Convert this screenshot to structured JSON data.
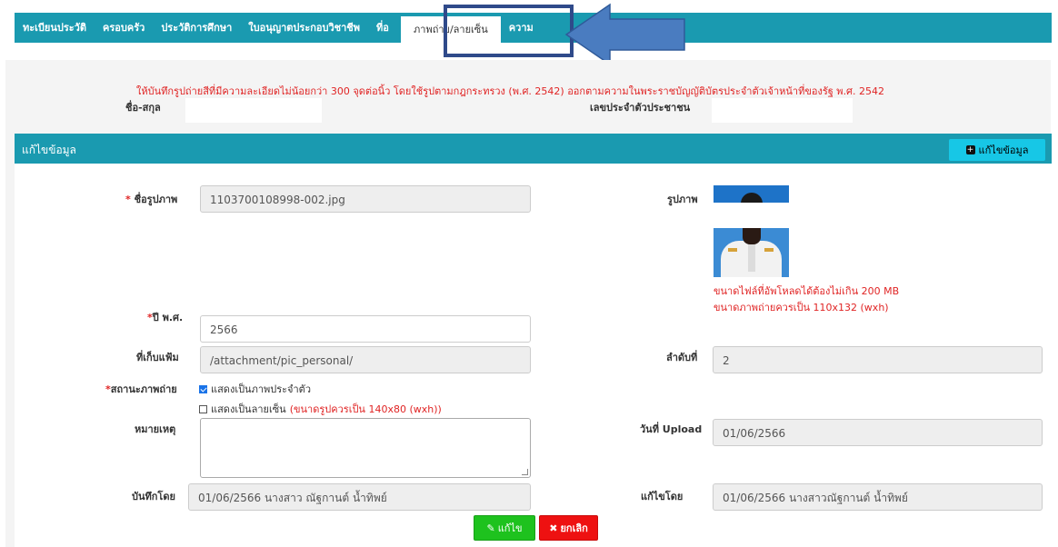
{
  "tabs": [
    {
      "label": "ทะเบียนประวัติ"
    },
    {
      "label": "ครอบครัว"
    },
    {
      "label": "ประวัติการศึกษา"
    },
    {
      "label": "ใบอนุญาตประกอบวิชาชีพ"
    },
    {
      "label": "ที่อ"
    },
    {
      "label": "ภาพถ่าย/ลายเซ็น",
      "active": true
    },
    {
      "label": "ความ"
    }
  ],
  "notice": "ให้บันทึกรูปถ่ายสีที่มีความละเอียดไม่น้อยกว่า 300 จุดต่อนิ้ว โดยใช้รูปตามกฎกระทรวง (พ.ศ. 2542) ออกตามความในพระราชบัญญัติบัตรประจำตัวเจ้าหน้าที่ของรัฐ พ.ศ. 2542",
  "header_fields": {
    "name_label": "ชื่อ-สกุล",
    "id_label": "เลขประจำตัวประชาชน"
  },
  "section": {
    "title": "แก้ไขข้อมูล",
    "edit_button": "แก้ไขข้อมูล",
    "collapse": "−"
  },
  "form": {
    "required_mark": "*",
    "image_name_label": "ชื่อรูปภาพ",
    "image_name_value": "1103700108998-002.jpg",
    "image_label": "รูปภาพ",
    "upload_size_note": "ขนาดไฟล์ที่อัพโหลดได้ต้องไม่เกิน 200 MB",
    "photo_size_note": "ขนาดภาพถ่ายควรเป็น 110x132 (wxh)",
    "year_label": "ปี พ.ศ.",
    "year_value": "2566",
    "folder_label": "ที่เก็บแฟ้ม",
    "folder_value": "/attachment/pic_personal/",
    "order_label": "ลำดับที่",
    "order_value": "2",
    "status_label": "สถานะภาพถ่าย",
    "option_profile": "แสดงเป็นภาพประจำตัว",
    "option_profile_checked": true,
    "option_signature": "แสดงเป็นลายเซ็น",
    "option_signature_checked": false,
    "signature_size_note": "(ขนาดรูปควรเป็น 140x80 (wxh))",
    "remark_label": "หมายเหตุ",
    "remark_value": "",
    "upload_date_label": "วันที่ Upload",
    "upload_date_value": "01/06/2566",
    "recorded_by_label": "บันทึกโดย",
    "recorded_by_value": "01/06/2566 นางสาว ณัฐกานต์  น้ำทิพย์",
    "edited_by_label": "แก้ไขโดย",
    "edited_by_value": "01/06/2566 นางสาวณัฐกานต์  น้ำทิพย์"
  },
  "buttons": {
    "save": "แก้ไข",
    "cancel": "ยกเลิก"
  },
  "colors": {
    "teal": "#1a9ab0",
    "red": "#e02424",
    "highlight_border": "#2f4a8a",
    "arrow": "#4a7cc0"
  }
}
